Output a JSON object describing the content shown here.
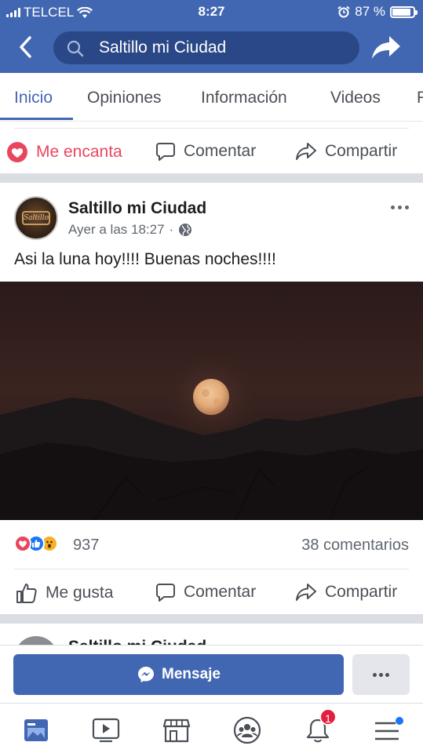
{
  "status_bar": {
    "carrier": "TELCEL",
    "time": "8:27",
    "battery_percent": "87 %",
    "battery_level": 0.87
  },
  "header": {
    "search_text": "Saltillo mi Ciudad",
    "color": "#4267b2"
  },
  "tabs": [
    {
      "label": "Inicio",
      "active": true
    },
    {
      "label": "Opiniones"
    },
    {
      "label": "Información"
    },
    {
      "label": "Videos"
    },
    {
      "label": "F"
    }
  ],
  "prev_post_actions": {
    "love_label": "Me encanta",
    "comment_label": "Comentar",
    "share_label": "Compartir"
  },
  "post": {
    "author": "Saltillo mi Ciudad",
    "time": "Ayer a las 18:27",
    "separator": "·",
    "text": "Asi la luna hoy!!!! Buenas noches!!!!",
    "avatar_text": "Saltillo",
    "reaction_count": "937",
    "comments": "38 comentarios",
    "like_label": "Me gusta",
    "comment_label": "Comentar",
    "share_label": "Compartir"
  },
  "next_post": {
    "author": "Saltillo mi Ciudad"
  },
  "cta": {
    "message_label": "Mensaje"
  },
  "tab_bar": {
    "notifications_badge": "1"
  },
  "colors": {
    "brand": "#4267b2",
    "love": "#e9465d",
    "badge": "#e41e3f"
  }
}
